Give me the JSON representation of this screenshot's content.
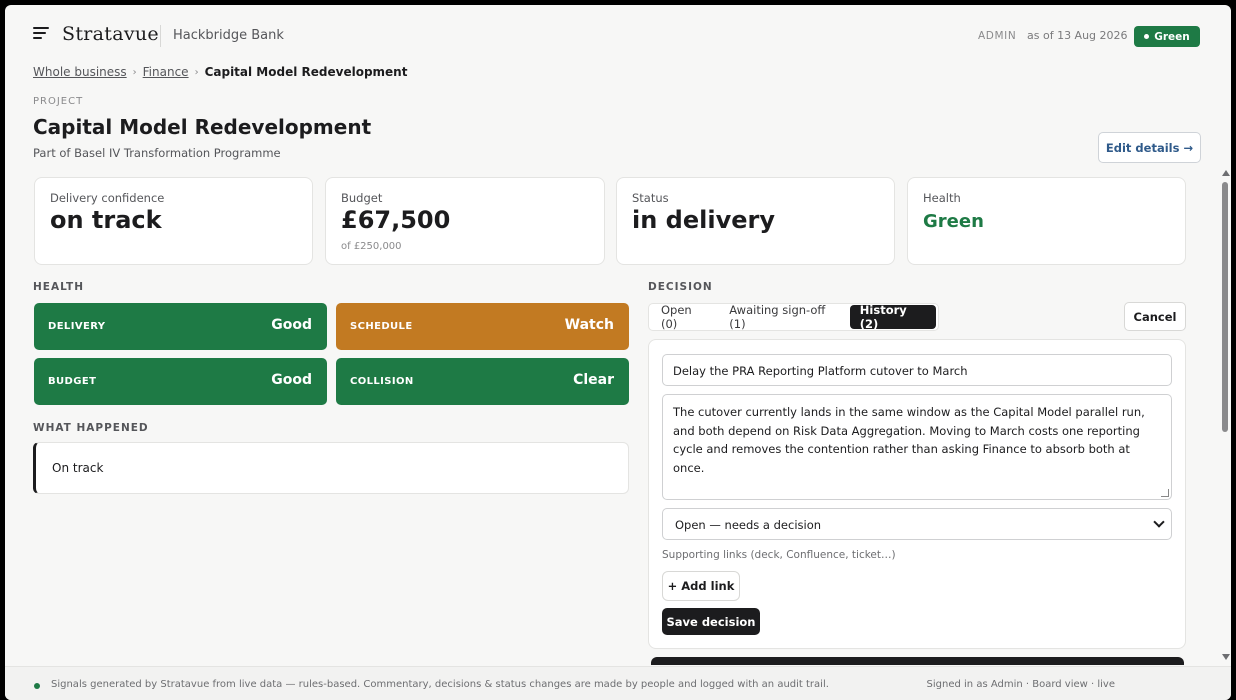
{
  "header": {
    "brand": "Stratavue",
    "org": "Hackbridge Bank",
    "role": "ADMIN",
    "as_of": "as of 13 Aug 2026",
    "status_pill": "Green"
  },
  "breadcrumb": {
    "items": [
      "Whole business",
      "Finance"
    ],
    "current": "Capital Model Redevelopment"
  },
  "project": {
    "eyebrow": "PROJECT",
    "title": "Capital Model Redevelopment",
    "subtitle": "Part of Basel IV Transformation Programme",
    "edit_label": "Edit details →"
  },
  "stats": [
    {
      "label": "Delivery confidence",
      "value": "on track",
      "sub": ""
    },
    {
      "label": "Budget",
      "value": "£67,500",
      "sub": "of £250,000"
    },
    {
      "label": "Status",
      "value": "in delivery",
      "sub": ""
    },
    {
      "label": "Health",
      "value": "Green",
      "sub": ""
    }
  ],
  "health": {
    "label": "HEALTH",
    "items": [
      {
        "key": "DELIVERY",
        "value": "Good",
        "color": "#1e7a45"
      },
      {
        "key": "SCHEDULE",
        "value": "Watch",
        "color": "#c27a22"
      },
      {
        "key": "BUDGET",
        "value": "Good",
        "color": "#1e7a45"
      },
      {
        "key": "COLLISION",
        "value": "Clear",
        "color": "#1e7a45"
      }
    ]
  },
  "what_happened": {
    "label": "WHAT HAPPENED",
    "text": "On track"
  },
  "decision": {
    "label": "DECISION",
    "tabs": [
      "Open (0)",
      "Awaiting sign-off (1)",
      "History (2)"
    ],
    "active_tab": "History (2)",
    "cancel_label": "Cancel",
    "title_value": "Delay the PRA Reporting Platform cutover to March",
    "body_value": "The cutover currently lands in the same window as the Capital Model parallel run, and both depend on Risk Data Aggregation. Moving to March costs one reporting cycle and removes the contention rather than asking Finance to absorb both at once.",
    "status_selected": "Open — needs a decision",
    "links_hint": "Supporting links (deck, Confluence, ticket…)",
    "add_link_label": "+ Add link",
    "save_label": "Save decision"
  },
  "footer": {
    "left": "Signals generated by Stratavue from live data — rules-based. Commentary, decisions & status changes are made by people and logged with an audit trail.",
    "right": "Signed in as Admin · Board view · live"
  },
  "colors": {
    "green": "#1e7a45",
    "amber": "#c27a22",
    "dark": "#1c1c1e"
  }
}
